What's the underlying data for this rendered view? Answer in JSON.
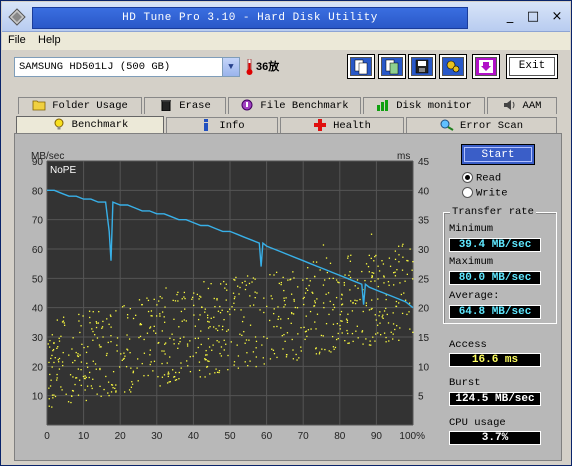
{
  "window": {
    "title": "HD Tune Pro 3.10 - Hard Disk Utility"
  },
  "window_controls": [
    "_",
    "□",
    "×"
  ],
  "menu": {
    "file": "File",
    "help": "Help"
  },
  "drive": {
    "selected": "SAMSUNG HD501LJ (500 GB)"
  },
  "temperature": "36放",
  "toolbar": {
    "exit_label": "Exit"
  },
  "tabs_row1": [
    {
      "label": "Folder Usage",
      "icon": "folder-icon"
    },
    {
      "label": "Erase",
      "icon": "trash-icon"
    },
    {
      "label": "File Benchmark",
      "icon": "file-benchmark-icon"
    },
    {
      "label": "Disk monitor",
      "icon": "disk-monitor-icon"
    },
    {
      "label": "AAM",
      "icon": "speaker-icon"
    }
  ],
  "tabs_row2": [
    {
      "label": "Benchmark",
      "icon": "lightbulb-icon",
      "active": true
    },
    {
      "label": "Info",
      "icon": "info-icon"
    },
    {
      "label": "Health",
      "icon": "health-cross-icon"
    },
    {
      "label": "Error Scan",
      "icon": "magnifier-icon"
    }
  ],
  "benchmark": {
    "start_label": "Start",
    "mode": {
      "read": "Read",
      "write": "Write",
      "selected": "Read"
    },
    "transfer_rate_title": "Transfer rate",
    "minimum_label": "Minimum",
    "minimum_value": "39.4 MB/sec",
    "maximum_label": "Maximum",
    "maximum_value": "80.0 MB/sec",
    "average_label": "Average:",
    "average_value": "64.8 MB/sec",
    "access_label": "Access",
    "access_value": "16.6 ms",
    "burst_label": "Burst",
    "burst_value": "124.5 MB/sec",
    "cpu_label": "CPU usage",
    "cpu_value": "3.7%"
  },
  "colors": {
    "transfer_line": "#38b0e8",
    "access_dots": "#ffff40",
    "plot_bg": "#333333",
    "grid": "#555555"
  },
  "chart_data": {
    "type": "line",
    "left_unit": "MB/sec",
    "right_unit": "ms",
    "annotation": "NoPE",
    "x_ticks": [
      "0",
      "10",
      "20",
      "30",
      "40",
      "50",
      "60",
      "70",
      "80",
      "90",
      "100%"
    ],
    "y_left_ticks": [
      "10",
      "20",
      "30",
      "40",
      "50",
      "60",
      "70",
      "80",
      "90"
    ],
    "y_right_ticks": [
      "5",
      "10",
      "15",
      "20",
      "25",
      "30",
      "35",
      "40",
      "45"
    ],
    "xlim": [
      0,
      100
    ],
    "ylim_left": [
      0,
      90
    ],
    "ylim_right": [
      0,
      45
    ],
    "grid": true,
    "series": [
      {
        "axis": "left",
        "x": [
          0,
          2,
          4,
          6,
          8,
          10,
          12,
          14,
          16,
          17,
          17.5,
          18,
          20,
          22,
          24,
          26,
          28,
          30,
          32,
          34,
          36,
          38,
          40,
          42,
          44,
          46,
          48,
          50,
          52,
          54,
          56,
          58,
          58.5,
          59,
          60,
          62,
          64,
          66,
          68,
          70,
          72,
          74,
          76,
          78,
          80,
          82,
          84,
          86,
          86.5,
          87,
          88,
          90,
          92,
          94,
          96,
          98,
          100
        ],
        "values": [
          80,
          80,
          79,
          78,
          78,
          77,
          77,
          76,
          76,
          66,
          56,
          76,
          75,
          75,
          74,
          73,
          73,
          72,
          72,
          71,
          70,
          70,
          69,
          68,
          68,
          67,
          66,
          66,
          65,
          64,
          63,
          62,
          54,
          62,
          61,
          60,
          59,
          58,
          57,
          56,
          55,
          54,
          53,
          52,
          51,
          50,
          49,
          48,
          41,
          48,
          47,
          46,
          45,
          44,
          43,
          42,
          40
        ]
      }
    ],
    "scatter": {
      "axis": "right",
      "description_ms_range_by_position": [
        {
          "x": 0,
          "min": 3,
          "max": 18
        },
        {
          "x": 50,
          "min": 10,
          "max": 27
        },
        {
          "x": 100,
          "min": 15,
          "max": 32
        }
      ]
    }
  }
}
